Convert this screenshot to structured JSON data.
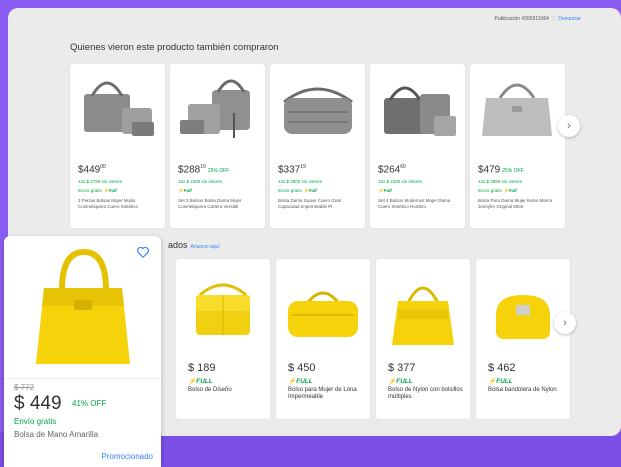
{
  "publication": {
    "label": "Publicación #555511064",
    "link": "Denunciar"
  },
  "section1": {
    "title": "Quienes vieron este producto también compraron",
    "cards": [
      {
        "price": "$449",
        "cents": "00",
        "off": "",
        "installments": "12x $ 3790 sin interés",
        "shipping": "Envío gratis",
        "full": "Full",
        "desc": "3 Piezas Bolsas Mujer Moda Cosmetiquera Cuero Sintético"
      },
      {
        "price": "$288",
        "cents": "10",
        "off": "25% OFF",
        "installments": "12x $ 2400 sin interés",
        "shipping": "",
        "full": "Full",
        "desc": "Set 3 Bolsos Bolsa Dama Mujer Cosmetiquera Cartera Versátil"
      },
      {
        "price": "$337",
        "cents": "19",
        "off": "",
        "installments": "12x $ 2800 sin interés",
        "shipping": "Envío gratis",
        "full": "Full",
        "desc": "Bolsa Dama Suave Cuero Gran Capacidad Impermeable Pl"
      },
      {
        "price": "$264",
        "cents": "60",
        "off": "",
        "installments": "12x $ 2200 sin interés",
        "shipping": "",
        "full": "Full",
        "desc": "Set 4 Bolsos Modernos Mujer Dama Cuero Sintético Hombro"
      },
      {
        "price": "$479",
        "cents": "",
        "off": "25% OFF",
        "installments": "12x $ 3990 sin interés",
        "shipping": "Envío gratis",
        "full": "Full",
        "desc": "Bolsa Para Dama Mujer Bolso Marca Jennyfer Original 9004"
      }
    ]
  },
  "section2": {
    "title": "ados",
    "ad": "Anuncio aquí",
    "cards": [
      {
        "price": "$ 189",
        "full": "FULL",
        "desc": "Bolso de Diseño"
      },
      {
        "price": "$ 450",
        "full": "FULL",
        "desc": "Bolso para Mujer de Lona Impermeable"
      },
      {
        "price": "$ 377",
        "full": "FULL",
        "desc": "Bolso de Nylon con bolsillos múltiples"
      },
      {
        "price": "$ 462",
        "full": "FULL",
        "desc": "Bolsa bandolera de Nylon"
      }
    ]
  },
  "featured": {
    "old_price": "$ 772",
    "price": "$ 449",
    "off": "41% OFF",
    "shipping": "Envío gratis",
    "name": "Bolsa de Mano Amarilla",
    "promo": "Promocionado"
  },
  "colors": {
    "accent": "#3483fa",
    "green": "#00a650",
    "yellow": "#f5d20a",
    "gray_bag": "#8c8c8c"
  },
  "icons": {
    "heart": "heart-icon",
    "next": "chevron-right-icon",
    "bolt": "lightning-icon"
  }
}
